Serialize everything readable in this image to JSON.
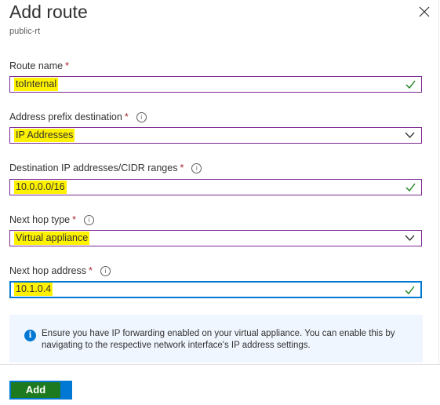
{
  "header": {
    "title": "Add route",
    "subtitle": "public-rt"
  },
  "form": {
    "route_name": {
      "label": "Route name",
      "required": "*",
      "value": "toInternal"
    },
    "address_prefix": {
      "label": "Address prefix destination",
      "required": "*",
      "value": "IP Addresses",
      "options": [
        "IP Addresses"
      ]
    },
    "destination": {
      "label": "Destination IP addresses/CIDR ranges",
      "required": "*",
      "value": "10.0.0.0/16"
    },
    "next_hop_type": {
      "label": "Next hop type",
      "required": "*",
      "value": "Virtual appliance",
      "options": [
        "Virtual appliance"
      ]
    },
    "next_hop_address": {
      "label": "Next hop address",
      "required": "*",
      "value": "10.1.0.4"
    }
  },
  "info": {
    "message": "Ensure you have IP forwarding enabled on your virtual appliance. You can enable this by navigating to the respective network interface's IP address settings."
  },
  "footer": {
    "add_label": "Add"
  },
  "icons": {
    "close": "close-icon",
    "info": "info-icon",
    "check": "check-icon",
    "chevron": "chevron-down-icon"
  },
  "colors": {
    "accent": "#0078d4",
    "highlight": "#fff200",
    "valid": "#107c10",
    "field_border": "#7a2890",
    "required": "#a4262c"
  }
}
